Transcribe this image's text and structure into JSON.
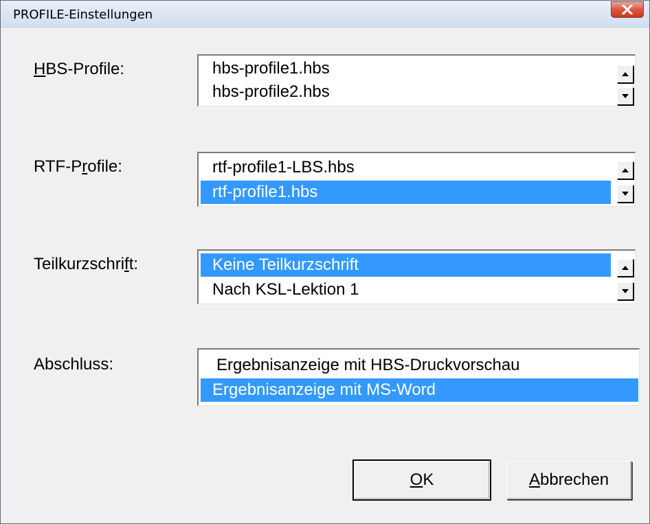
{
  "window": {
    "title": "PROFILE-Einstellungen",
    "close_icon": "close-icon"
  },
  "hbs": {
    "label_pre": "",
    "label_acc": "H",
    "label_post": "BS-Profile:",
    "items": [
      "hbs-profile1.hbs",
      "hbs-profile2.hbs"
    ],
    "selected": -1
  },
  "rtf": {
    "label_pre": "RTF-P",
    "label_acc": "r",
    "label_post": "ofile:",
    "items": [
      "rtf-profile1-LBS.hbs",
      "rtf-profile1.hbs"
    ],
    "selected": 1
  },
  "teil": {
    "label_pre": "Teilkurzschri",
    "label_acc": "f",
    "label_post": "t:",
    "items": [
      "Keine Teilkurzschrift",
      "Nach KSL-Lektion 1"
    ],
    "selected": 0
  },
  "abschluss": {
    "label": "Abschluss:",
    "items": [
      "Ergebnisanzeige mit HBS-Druckvorschau",
      "Ergebnisanzeige mit MS-Word"
    ],
    "selected": 1
  },
  "buttons": {
    "ok_acc": "O",
    "ok_post": "K",
    "cancel_acc": "A",
    "cancel_post": "bbrechen"
  },
  "colors": {
    "selection": "#3399ff",
    "close_button": "#c6381e"
  }
}
